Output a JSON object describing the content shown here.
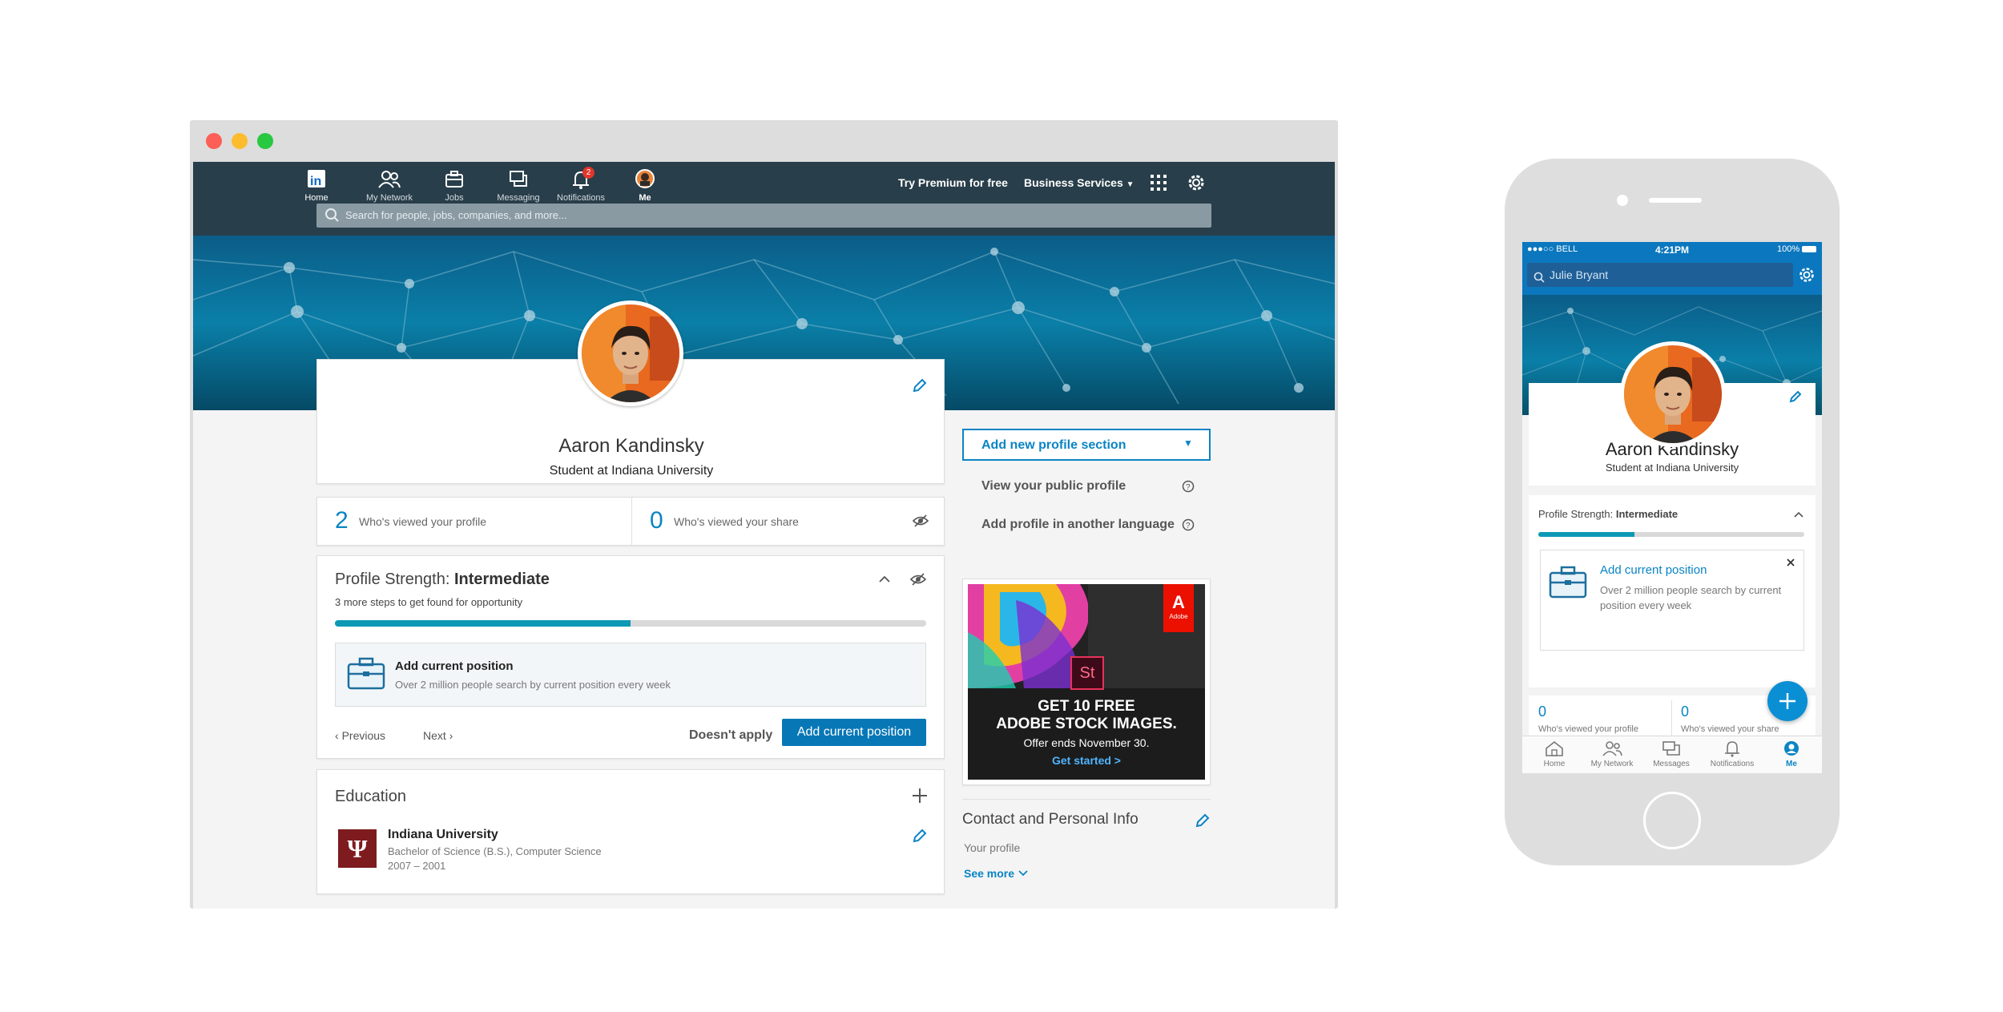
{
  "desktop": {
    "nav": {
      "items": [
        {
          "label": "Home",
          "icon": "linkedin-logo-icon"
        },
        {
          "label": "My Network",
          "icon": "people-icon"
        },
        {
          "label": "Jobs",
          "icon": "briefcase-icon"
        },
        {
          "label": "Messaging",
          "icon": "chat-icon"
        },
        {
          "label": "Notifications",
          "icon": "bell-icon",
          "badge": "2"
        },
        {
          "label": "Me",
          "icon": "avatar-icon"
        }
      ],
      "premium": "Try Premium for free",
      "business": "Business Services",
      "search_placeholder": "Search for people, jobs, companies, and more..."
    },
    "profile": {
      "name": "Aaron Kandinsky",
      "headline": "Student at Indiana University"
    },
    "stats": {
      "views_count": "2",
      "views_label": "Who's viewed your profile",
      "share_count": "0",
      "share_label": "Who's viewed your share"
    },
    "strength": {
      "title_prefix": "Profile Strength: ",
      "level": "Intermediate",
      "subtitle": "3 more steps to get found for opportunity",
      "progress": 0.5,
      "suggestion_title": "Add current position",
      "suggestion_desc": "Over 2 million people search by current position every week",
      "prev": "Previous",
      "next": "Next",
      "doesnt_apply": "Doesn't apply",
      "cta": "Add current position"
    },
    "education": {
      "heading": "Education",
      "school": "Indiana University",
      "degree": "Bachelor of Science (B.S.), Computer Science",
      "years": "2007 – 2001",
      "logo_text": "Ψ"
    },
    "sidebar": {
      "add_section": "Add new profile section",
      "public_profile": "View your public profile",
      "another_language": "Add profile in another language"
    },
    "ad": {
      "brand": "Adobe",
      "brand_mark": "A",
      "product_mark": "St",
      "line1": "GET 10 FREE",
      "line2": "ADOBE STOCK IMAGES.",
      "offer": "Offer ends November 30.",
      "cta": "Get started >"
    },
    "contact": {
      "heading": "Contact and Personal Info",
      "your_profile": "Your profile",
      "see_more": "See more"
    }
  },
  "mobile": {
    "status": {
      "carrier": "BELL",
      "time": "4:21PM",
      "battery": "100%"
    },
    "search_value": "Julie Bryant",
    "profile": {
      "name": "Aaron Kandinsky",
      "headline": "Student at Indiana University"
    },
    "strength": {
      "title_prefix": "Profile Strength: ",
      "level": "Intermediate",
      "progress": 0.36
    },
    "suggestion": {
      "title": "Add current position",
      "desc": "Over 2 million people search by current position every week"
    },
    "stats": {
      "views_count": "0",
      "views_label": "Who's viewed your profile",
      "share_count": "0",
      "share_label": "Who's viewed your share"
    },
    "tabs": [
      {
        "label": "Home",
        "icon": "home-icon"
      },
      {
        "label": "My Network",
        "icon": "people-icon"
      },
      {
        "label": "Messages",
        "icon": "chat-icon"
      },
      {
        "label": "Notifications",
        "icon": "bell-icon"
      },
      {
        "label": "Me",
        "icon": "avatar-icon"
      }
    ]
  },
  "colors": {
    "nav": "#283e4a",
    "accent": "#0877b6",
    "teal": "#0d99b5",
    "adobe_red": "#eb1000"
  }
}
